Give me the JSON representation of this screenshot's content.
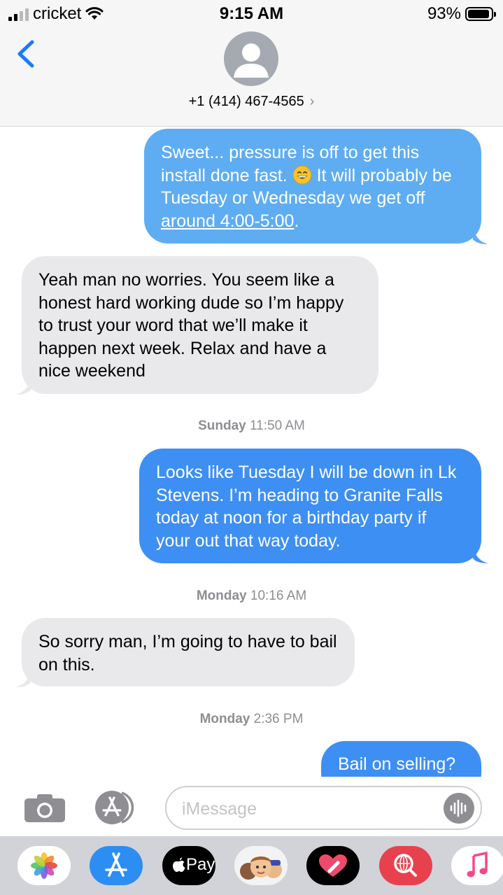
{
  "status_bar": {
    "carrier": "cricket",
    "time": "9:15 AM",
    "battery": "93%",
    "battery_level": 0.93
  },
  "header": {
    "contact": "+1 (414) 467-4565",
    "chevron": "›"
  },
  "messages": [
    {
      "side": "out",
      "style": "sms",
      "pre": "Sweet... pressure is off to get this install done fast.",
      "emoji": "grinning-sweat-emoji",
      "post": "It will probably be Tuesday or  Wednesday we get off",
      "link": "around 4:00-5:00",
      "end": "."
    },
    {
      "side": "in",
      "text": "Yeah man no worries. You seem like a honest hard working dude so I’m happy to trust your word that we’ll make it happen next week. Relax and have a nice weekend"
    },
    {
      "side": "stamp",
      "day": "Sunday",
      "time": "11:50 AM"
    },
    {
      "side": "out",
      "style": "imessage",
      "text": "Looks like Tuesday I will be down in Lk Stevens. I’m heading to Granite Falls today at noon for a birthday party if your out that way today."
    },
    {
      "side": "stamp",
      "day": "Monday",
      "time": "10:16 AM"
    },
    {
      "side": "in",
      "text": "So sorry man, I’m going to have to bail on this."
    },
    {
      "side": "stamp",
      "day": "Monday",
      "time": "2:36 PM"
    },
    {
      "side": "out",
      "style": "imessage",
      "text": "Bail on selling?"
    }
  ],
  "input": {
    "placeholder": "iMessage"
  },
  "icons": {
    "back": "chevron-left-icon",
    "camera": "camera-icon",
    "apps": "app-store-icon",
    "mic": "audio-waveform-icon"
  },
  "app_drawer": {
    "apps": [
      "photos-app",
      "app-store-app",
      "apple-pay-app",
      "memoji-app",
      "digital-touch-app",
      "image-search-app",
      "music-app"
    ],
    "apple_pay_label": "Pay"
  },
  "colors": {
    "sms_bubble": "#5eadf3",
    "imessage_bubble": "#3d8ff3",
    "received_bubble": "#e9e9eb",
    "accent": "#1a7cf5",
    "timestamp": "#8e8e93"
  }
}
